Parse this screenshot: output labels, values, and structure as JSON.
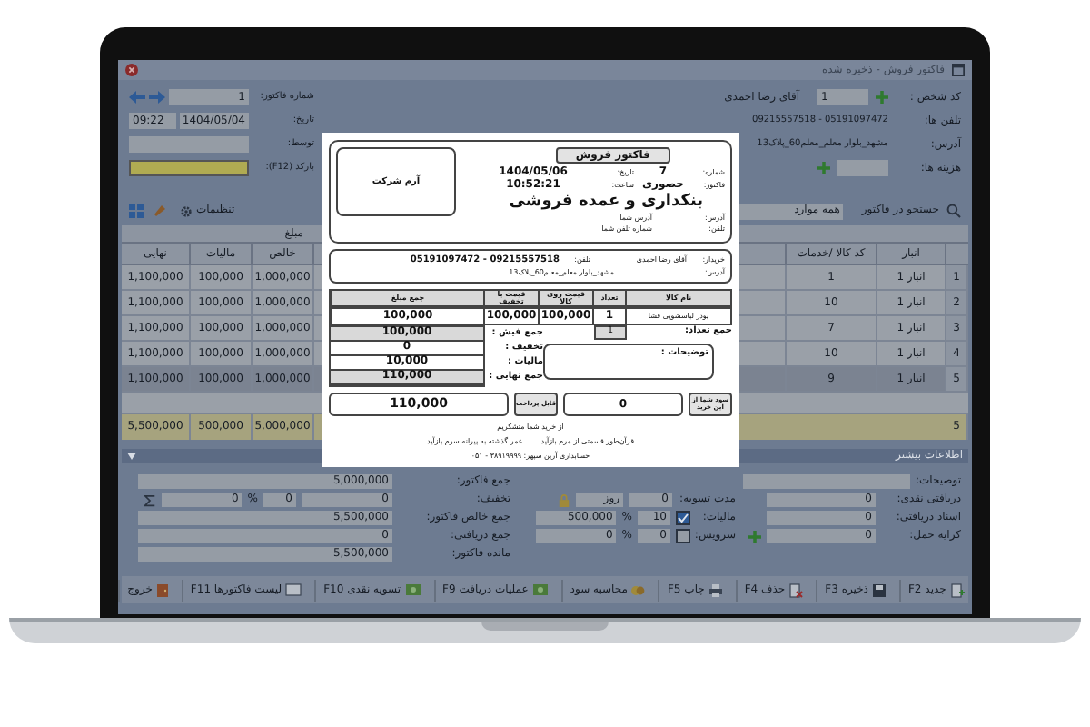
{
  "window": {
    "title": "فاکتور فروش - ذخیره شده"
  },
  "customer": [
    {
      "kind": "person",
      "label": "کد شخص :",
      "value": "1",
      "name": "آقای رضا احمدی"
    },
    {
      "kind": "text",
      "label": "تلفن ها:",
      "value": "05191097472 - 09215557518"
    },
    {
      "kind": "text",
      "label": "آدرس:",
      "value": "مشهد_بلوار معلم_معلم60_پلاک13"
    },
    {
      "kind": "add",
      "label": "هزینه ها:"
    }
  ],
  "invoice_fields": [
    {
      "kind": "nav",
      "label": "شماره فاکتور:",
      "value": "1"
    },
    {
      "kind": "date",
      "label": "تاریخ:",
      "value": "1404/05/04",
      "time": "09:22"
    },
    {
      "kind": "text",
      "label": "توسط:"
    },
    {
      "kind": "barcode",
      "label": "بارکد (F12):"
    }
  ],
  "search": {
    "label": "جستجو در فاکتور",
    "value": "همه موارد"
  },
  "settings_button": "تنظیمات",
  "table": {
    "group_heading": "مبلغ",
    "columns": [
      "انبار",
      "کد کالا /خدمات",
      "خالص",
      "مالیات",
      "نهایی"
    ],
    "rows": [
      {
        "number": "1",
        "warehouse": "انبار 1",
        "code": "1",
        "net": "1,000,000",
        "tax": "100,000",
        "total": "1,100,000",
        "selected": false
      },
      {
        "number": "2",
        "warehouse": "انبار 1",
        "code": "10",
        "net": "1,000,000",
        "tax": "100,000",
        "total": "1,100,000",
        "selected": false
      },
      {
        "number": "3",
        "warehouse": "انبار 1",
        "code": "7",
        "net": "1,000,000",
        "tax": "100,000",
        "total": "1,100,000",
        "selected": false
      },
      {
        "number": "4",
        "warehouse": "انبار 1",
        "code": "10",
        "net": "1,000,000",
        "tax": "100,000",
        "total": "1,100,000",
        "selected": false
      },
      {
        "number": "5",
        "warehouse": "انبار 1",
        "code": "9",
        "net": "1,000,000",
        "tax": "100,000",
        "total": "1,100,000",
        "selected": true
      }
    ],
    "totals": {
      "count": "5",
      "net": "5,000,000",
      "tax": "500,000",
      "total": "5,500,000"
    }
  },
  "more_info": {
    "title": "اطلاعات بیشتر",
    "notes_label": "توضیحات:",
    "right": [
      {
        "kind": "field",
        "label": "دریافتی نقدی:",
        "value": "0"
      },
      {
        "kind": "field",
        "label": "اسناد دریافتی:",
        "value": "0"
      },
      {
        "kind": "add",
        "label": "کرایه حمل:",
        "value": "0"
      }
    ],
    "middle": [
      {
        "kind": "days",
        "label": "مدت تسویه:",
        "value": "0",
        "unit": "روز"
      },
      {
        "kind": "percent",
        "label": "مالیات:",
        "checked": true,
        "percent": "10",
        "unit": "%",
        "amount": "500,000"
      },
      {
        "kind": "percent",
        "label": "سرویس:",
        "checked": false,
        "percent": "0",
        "unit": "%",
        "amount": "0"
      }
    ],
    "left": [
      {
        "kind": "field",
        "label": "جمع فاکتور:",
        "value": "5,000,000"
      },
      {
        "kind": "discount",
        "label": "تخفیف:",
        "value": "0",
        "percent": "0",
        "unit": "%",
        "amount": "0"
      },
      {
        "kind": "field",
        "label": "جمع خالص فاکتور:",
        "value": "5,500,000"
      },
      {
        "kind": "field",
        "label": "جمع دریافتی:",
        "value": "0"
      },
      {
        "kind": "field",
        "label": "مانده فاکتور:",
        "value": "5,500,000"
      }
    ]
  },
  "buttons": [
    "جدید F2",
    "ذخیره F3",
    "حذف F4",
    "چاپ F5",
    "محاسبه سود",
    "عملیات دریافت F9",
    "تسویه نقدی F10",
    "لیست فاکتورها F11",
    "خروج"
  ],
  "invoice": {
    "title": "فاکتور فروش",
    "logo": "آرم شرکت",
    "meta": [
      {
        "label": "شماره:",
        "value": "7"
      },
      {
        "label": "تاریخ:",
        "value": "1404/05/06"
      },
      {
        "label": "فاکتور:",
        "value": "حضوری"
      },
      {
        "label": "ساعت:",
        "value": "10:52:21"
      }
    ],
    "business": "بنکداری و عمده فروشی",
    "seller": [
      {
        "label": "آدرس:",
        "value": "آدرس شما"
      },
      {
        "label": "تلفن:",
        "value": "شماره تلفن شما"
      }
    ],
    "buyer": {
      "name_label": "خریدار:",
      "name": "آقای رضا احمدی",
      "phone_label": "تلفن:",
      "phone": "09215557518 - 05191097472",
      "address_label": "آدرس:",
      "address": "مشهد_بلوار معلم_معلم60_پلاک13"
    },
    "columns": [
      "نام کالا",
      "تعداد",
      "قیمت روی کالا",
      "قیمت با تخفیف",
      "جمع مبلغ"
    ],
    "items": [
      [
        "پودر لباسشویی فشا",
        "1",
        "100,000",
        "100,000",
        "100,000"
      ]
    ],
    "qty_label": "جمع تعداد:",
    "qty": "1",
    "totals": [
      {
        "label": "جمع فیش :",
        "value": "100,000",
        "shaded": true
      },
      {
        "label": "تخفیف :",
        "value": "0",
        "shaded": false
      },
      {
        "label": "مالیات :",
        "value": "10,000",
        "shaded": false
      },
      {
        "label": "جمع نهایی :",
        "value": "110,000",
        "shaded": true
      }
    ],
    "notes_label": "توضیحات :",
    "savings_label": "سود شما از این خرید",
    "savings": "0",
    "payable_label": "قابل پرداخت",
    "payable": "110,000",
    "footer": [
      [
        "از خرید شما متشکریم"
      ],
      [
        "قرآن‌طور قسمتی از مرم بازآید",
        "عمر گذشته به پیرانه سرم بازآید"
      ],
      [
        "حسابداری آرین سپهر: ۳۸۹۱۹۹۹۹ - ۰۵۱"
      ]
    ]
  }
}
